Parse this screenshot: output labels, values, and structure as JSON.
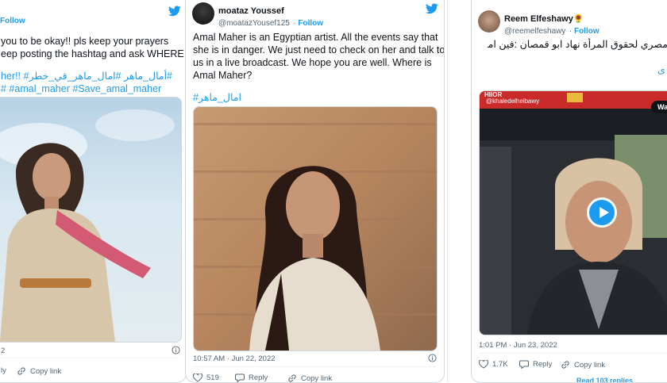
{
  "tweet1": {
    "follow": "Follow",
    "lines": [
      "you to be okay!! pls keep your prayers",
      "eep posting the hashtag and ask WHERE IS",
      "her!! #أمال_ماهر #امال_ماهر_في_خطر#",
      "# #amal_maher #Save_amal_maher"
    ],
    "time": "2",
    "reply": "ly",
    "copy": "Copy link"
  },
  "tweet2": {
    "name": "moataz Youssef",
    "handle": "@moatazYousef125",
    "follow": "Follow",
    "lines": [
      "Amal Maher is an Egyptian artist. All the events say that",
      "she is in danger. We just need to check on her and talk to",
      "us in a live broadcast. We hope you are well. Where is",
      "Amal Maher?"
    ],
    "hashtag": "#امال_ماهر",
    "time": "10:57 AM · Jun 22, 2022",
    "likes": "519",
    "reply": "Reply",
    "copy": "Copy link"
  },
  "tweet3": {
    "name": "Reem Elfeshawy🌻",
    "handle": "@reemelfeshawy",
    "follow": "Follow",
    "line1": "مصري لحقوق المرأة نهاد ابو قمصان :فين امال",
    "line2": "ی",
    "video_label": "@khaledelhelbawy",
    "video_top": "HIIOR",
    "video_chip": "Wa",
    "time": "1:01 PM · Jun 23, 2022",
    "likes": "1.7K",
    "reply": "Reply",
    "copy": "Copy link",
    "read_more": "Read 103 replies"
  },
  "colors": {
    "accent": "#1d9bf0",
    "text": "#0f1419",
    "muted": "#536471"
  }
}
